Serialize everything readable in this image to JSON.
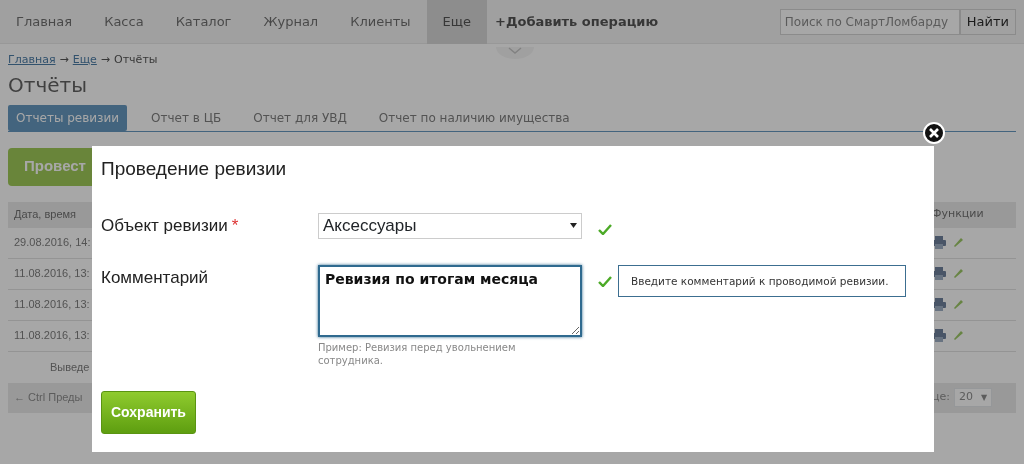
{
  "navbar": {
    "items": [
      {
        "label": "Главная",
        "selected": false
      },
      {
        "label": "Касса",
        "selected": false
      },
      {
        "label": "Каталог",
        "selected": false
      },
      {
        "label": "Журнал",
        "selected": false
      },
      {
        "label": "Клиенты",
        "selected": false
      },
      {
        "label": "Еще",
        "selected": true
      }
    ],
    "add_operation": "+Добавить операцию",
    "search": {
      "placeholder": "Поиск по СмартЛомбарду"
    },
    "search_button": "Найти"
  },
  "breadcrumb": [
    {
      "text": "Главная",
      "kind": "link"
    },
    {
      "text": "→",
      "kind": "separator"
    },
    {
      "text": "Еще",
      "kind": "link"
    },
    {
      "text": "→",
      "kind": "separator"
    },
    {
      "text": "Отчёты",
      "kind": "current"
    }
  ],
  "page_title": "Отчёты",
  "tabs": [
    {
      "label": "Отчеты ревизии",
      "selected": true
    },
    {
      "label": "Отчет в ЦБ",
      "selected": false
    },
    {
      "label": "Отчет для УВД",
      "selected": false
    },
    {
      "label": "Отчет по наличию имущества",
      "selected": false
    }
  ],
  "action_button": "Провест",
  "table": {
    "columns": [
      "Дата, время",
      "Функции"
    ],
    "rows": [
      {
        "date": "29.08.2016, 14:"
      },
      {
        "date": "11.08.2016, 13:"
      },
      {
        "date": "11.08.2016, 13:"
      },
      {
        "date": "11.08.2016, 13:"
      }
    ]
  },
  "summary": "Выведе",
  "pager_prev": "← Ctrl Преды",
  "per_page_label": "це:",
  "per_page": "20",
  "per_page_caret": "▼",
  "modal": {
    "title": "Проведение ревизии",
    "fields": [
      {
        "kind": "select",
        "label": "Объект ревизии",
        "required_marker": "*",
        "value": "Аксессуары",
        "valid": true
      },
      {
        "kind": "textarea",
        "label": "Комментарий",
        "value": "Ревизия по итогам месяца",
        "valid": true,
        "focused": true,
        "hint": "Пример: Ревизия перед увольнением сотрудника.",
        "tooltip": "Введите комментарий к проводимой ревизии."
      }
    ],
    "save_button": "Сохранить"
  }
}
